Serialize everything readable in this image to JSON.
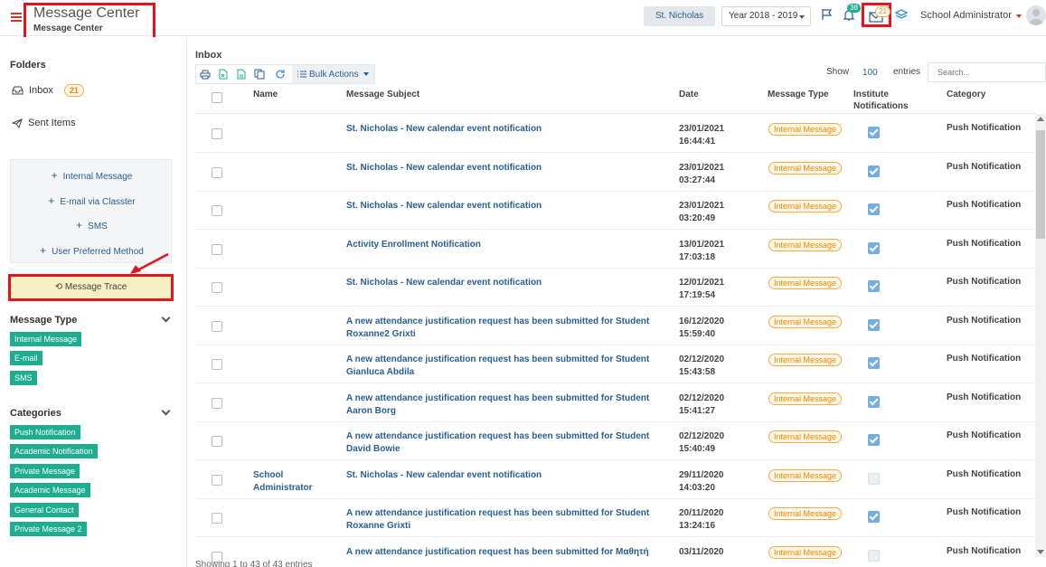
{
  "header": {
    "title": "Message Center",
    "subtitle": "Message Center",
    "school": "St. Nicholas",
    "year": "Year 2018 - 2019",
    "notification_count": "38",
    "mail_count": "21",
    "user": "School Administrator",
    "colors": {
      "highlight": "#e3141d",
      "accent": "#2a5f8f"
    }
  },
  "sidebar": {
    "folders_heading": "Folders",
    "inbox_label": "Inbox",
    "inbox_count": "21",
    "sent_label": "Sent Items",
    "compose": [
      {
        "label": "Internal Message"
      },
      {
        "label": "E-mail via Classter"
      },
      {
        "label": "SMS"
      },
      {
        "label": "User Preferred Method"
      }
    ],
    "trace_label": "Message Trace",
    "message_type_heading": "Message Type",
    "message_types": [
      "Internal Message",
      "E-mail",
      "SMS"
    ],
    "categories_heading": "Categories",
    "categories": [
      "Push Notification",
      "Academic Notification",
      "Private Message",
      "Academic Message",
      "General Contact",
      "Private Message 2"
    ],
    "tag_color": "#1fad8f"
  },
  "main": {
    "title": "Inbox",
    "bulk_label": "Bulk Actions",
    "show_label": "Show",
    "show_value": "100",
    "entries_label": "entries",
    "search_placeholder": "Search...",
    "columns": {
      "name": "Name",
      "subject": "Message Subject",
      "date": "Date",
      "type": "Message Type",
      "institute_1": "Institute",
      "institute_2": "Notifications",
      "category": "Category"
    },
    "rows": [
      {
        "name": "",
        "subject": "St. Nicholas - New calendar event notification",
        "date": "23/01/2021",
        "time": "16:44:41",
        "type": "Internal Message",
        "institute": true,
        "category": "Push Notification"
      },
      {
        "name": "",
        "subject": "St. Nicholas - New calendar event notification",
        "date": "23/01/2021",
        "time": "03:27:44",
        "type": "Internal Message",
        "institute": true,
        "category": "Push Notification"
      },
      {
        "name": "",
        "subject": "St. Nicholas - New calendar event notification",
        "date": "23/01/2021",
        "time": "03:20:49",
        "type": "Internal Message",
        "institute": true,
        "category": "Push Notification"
      },
      {
        "name": "",
        "subject": "Activity Enrollment Notification",
        "date": "13/01/2021",
        "time": "17:03:18",
        "type": "Internal Message",
        "institute": true,
        "category": "Push Notification"
      },
      {
        "name": "",
        "subject": "St. Nicholas - New calendar event notification",
        "date": "12/01/2021",
        "time": "17:19:54",
        "type": "Internal Message",
        "institute": true,
        "category": "Push Notification"
      },
      {
        "name": "",
        "subject": "A new attendance justification request has been submitted for Student Roxanne2 Grixti",
        "date": "16/12/2020",
        "time": "15:59:40",
        "type": "Internal Message",
        "institute": true,
        "category": "Push Notification"
      },
      {
        "name": "",
        "subject": "A new attendance justification request has been submitted for Student Gianluca Abdila",
        "date": "02/12/2020",
        "time": "15:43:58",
        "type": "Internal Message",
        "institute": true,
        "category": "Push Notification"
      },
      {
        "name": "",
        "subject": "A new attendance justification request has been submitted for Student Aaron Borg",
        "date": "02/12/2020",
        "time": "15:41:27",
        "type": "Internal Message",
        "institute": true,
        "category": "Push Notification"
      },
      {
        "name": "",
        "subject": "A new attendance justification request has been submitted for Student David Bowie",
        "date": "02/12/2020",
        "time": "15:40:49",
        "type": "Internal Message",
        "institute": true,
        "category": "Push Notification"
      },
      {
        "name": "School Administrator",
        "subject": "St. Nicholas - New calendar event notification",
        "date": "29/11/2020",
        "time": "14:03:20",
        "type": "Internal Message",
        "institute": false,
        "category": "Push Notification"
      },
      {
        "name": "",
        "subject": "A new attendance justification request has been submitted for Student Roxanne Grixti",
        "date": "20/11/2020",
        "time": "13:24:16",
        "type": "Internal Message",
        "institute": true,
        "category": "Push Notification"
      },
      {
        "name": "",
        "subject": "A new attendance justification request has been submitted for Μαθητή",
        "date": "03/11/2020",
        "time": "",
        "type": "Internal Message",
        "institute": false,
        "category": "Push Notification"
      }
    ],
    "footer": "Showing 1 to 43 of 43 entries"
  }
}
